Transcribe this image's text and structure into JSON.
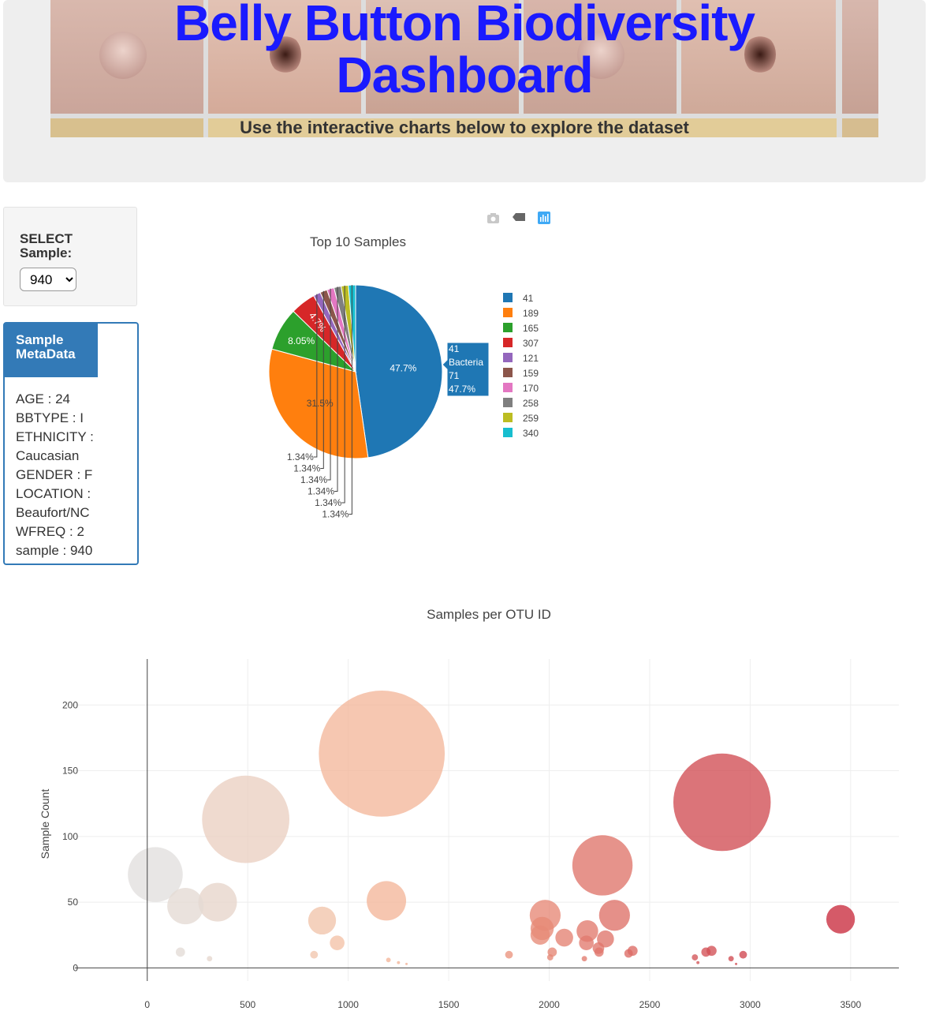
{
  "header": {
    "title": "Belly Button Biodiversity Dashboard",
    "subtitle": "Use the interactive charts below to explore the dataset"
  },
  "selector": {
    "label": "SELECT Sample:",
    "selected": "940"
  },
  "metadata": {
    "title": "Sample MetaData",
    "lines": [
      "AGE : 24",
      "BBTYPE : I",
      "ETHNICITY :",
      "Caucasian",
      "GENDER : F",
      "LOCATION :",
      "Beaufort/NC",
      "WFREQ : 2",
      "sample : 940"
    ]
  },
  "icons": [
    "camera-icon",
    "tag-icon",
    "plotly-logo-icon"
  ],
  "chart_data": [
    {
      "type": "pie",
      "title": "Top 10 Samples",
      "labels": [
        "41",
        "189",
        "165",
        "307",
        "121",
        "159",
        "170",
        "258",
        "259",
        "340"
      ],
      "percents": [
        47.7,
        31.5,
        8.05,
        4.7,
        1.34,
        1.34,
        1.34,
        1.34,
        1.34,
        1.34
      ],
      "percent_labels": [
        "47.7%",
        "31.5%",
        "8.05%",
        "4.7%",
        "1.34%",
        "1.34%",
        "1.34%",
        "1.34%",
        "1.34%",
        "1.34%"
      ],
      "colors": [
        "#1f77b4",
        "#ff7f0e",
        "#2ca02c",
        "#d62728",
        "#9467bd",
        "#8c564b",
        "#e377c2",
        "#7f7f7f",
        "#bcbd22",
        "#17becf"
      ],
      "legend": "right",
      "hover": {
        "lines": [
          "41",
          "Bacteria",
          "71",
          "47.7%"
        ]
      }
    },
    {
      "type": "scatter",
      "title": "Samples per OTU ID",
      "xlabel": "",
      "ylabel": "Sample Count",
      "xlim": [
        -360,
        3740
      ],
      "ylim": [
        -10,
        235
      ],
      "xticks": [
        0,
        500,
        1000,
        1500,
        2000,
        2500,
        3000,
        3500
      ],
      "yticks": [
        0,
        50,
        100,
        150,
        200
      ],
      "grid": true,
      "points": [
        {
          "x": 40,
          "y": 71,
          "s": 71
        },
        {
          "x": 190,
          "y": 47,
          "s": 47
        },
        {
          "x": 350,
          "y": 50,
          "s": 50
        },
        {
          "x": 490,
          "y": 113,
          "s": 113
        },
        {
          "x": 165,
          "y": 12,
          "s": 12
        },
        {
          "x": 310,
          "y": 7,
          "s": 7
        },
        {
          "x": 870,
          "y": 36,
          "s": 36
        },
        {
          "x": 945,
          "y": 19,
          "s": 19
        },
        {
          "x": 830,
          "y": 10,
          "s": 10
        },
        {
          "x": 1167,
          "y": 163,
          "s": 163
        },
        {
          "x": 1190,
          "y": 51,
          "s": 51
        },
        {
          "x": 1200,
          "y": 6,
          "s": 6
        },
        {
          "x": 1800,
          "y": 10,
          "s": 10
        },
        {
          "x": 1980,
          "y": 40,
          "s": 40
        },
        {
          "x": 1965,
          "y": 30,
          "s": 30
        },
        {
          "x": 1955,
          "y": 25,
          "s": 25
        },
        {
          "x": 2075,
          "y": 23,
          "s": 23
        },
        {
          "x": 2015,
          "y": 12,
          "s": 12
        },
        {
          "x": 2005,
          "y": 8,
          "s": 8
        },
        {
          "x": 2265,
          "y": 78,
          "s": 78
        },
        {
          "x": 2325,
          "y": 40,
          "s": 40
        },
        {
          "x": 2190,
          "y": 28,
          "s": 28
        },
        {
          "x": 2185,
          "y": 19,
          "s": 19
        },
        {
          "x": 2280,
          "y": 22,
          "s": 22
        },
        {
          "x": 2245,
          "y": 15,
          "s": 15
        },
        {
          "x": 2248,
          "y": 12,
          "s": 12
        },
        {
          "x": 2175,
          "y": 7,
          "s": 7
        },
        {
          "x": 2415,
          "y": 13,
          "s": 13
        },
        {
          "x": 2395,
          "y": 11,
          "s": 11
        },
        {
          "x": 2860,
          "y": 126,
          "s": 126
        },
        {
          "x": 2808,
          "y": 13,
          "s": 13
        },
        {
          "x": 2780,
          "y": 12,
          "s": 12
        },
        {
          "x": 2725,
          "y": 8,
          "s": 8
        },
        {
          "x": 2965,
          "y": 10,
          "s": 10
        },
        {
          "x": 2905,
          "y": 7,
          "s": 7
        },
        {
          "x": 3450,
          "y": 37,
          "s": 37
        },
        {
          "x": 2740,
          "y": 4,
          "s": 4
        },
        {
          "x": 2930,
          "y": 3,
          "s": 3
        },
        {
          "x": 1250,
          "y": 4,
          "s": 4
        },
        {
          "x": 1290,
          "y": 3,
          "s": 3
        }
      ]
    }
  ]
}
